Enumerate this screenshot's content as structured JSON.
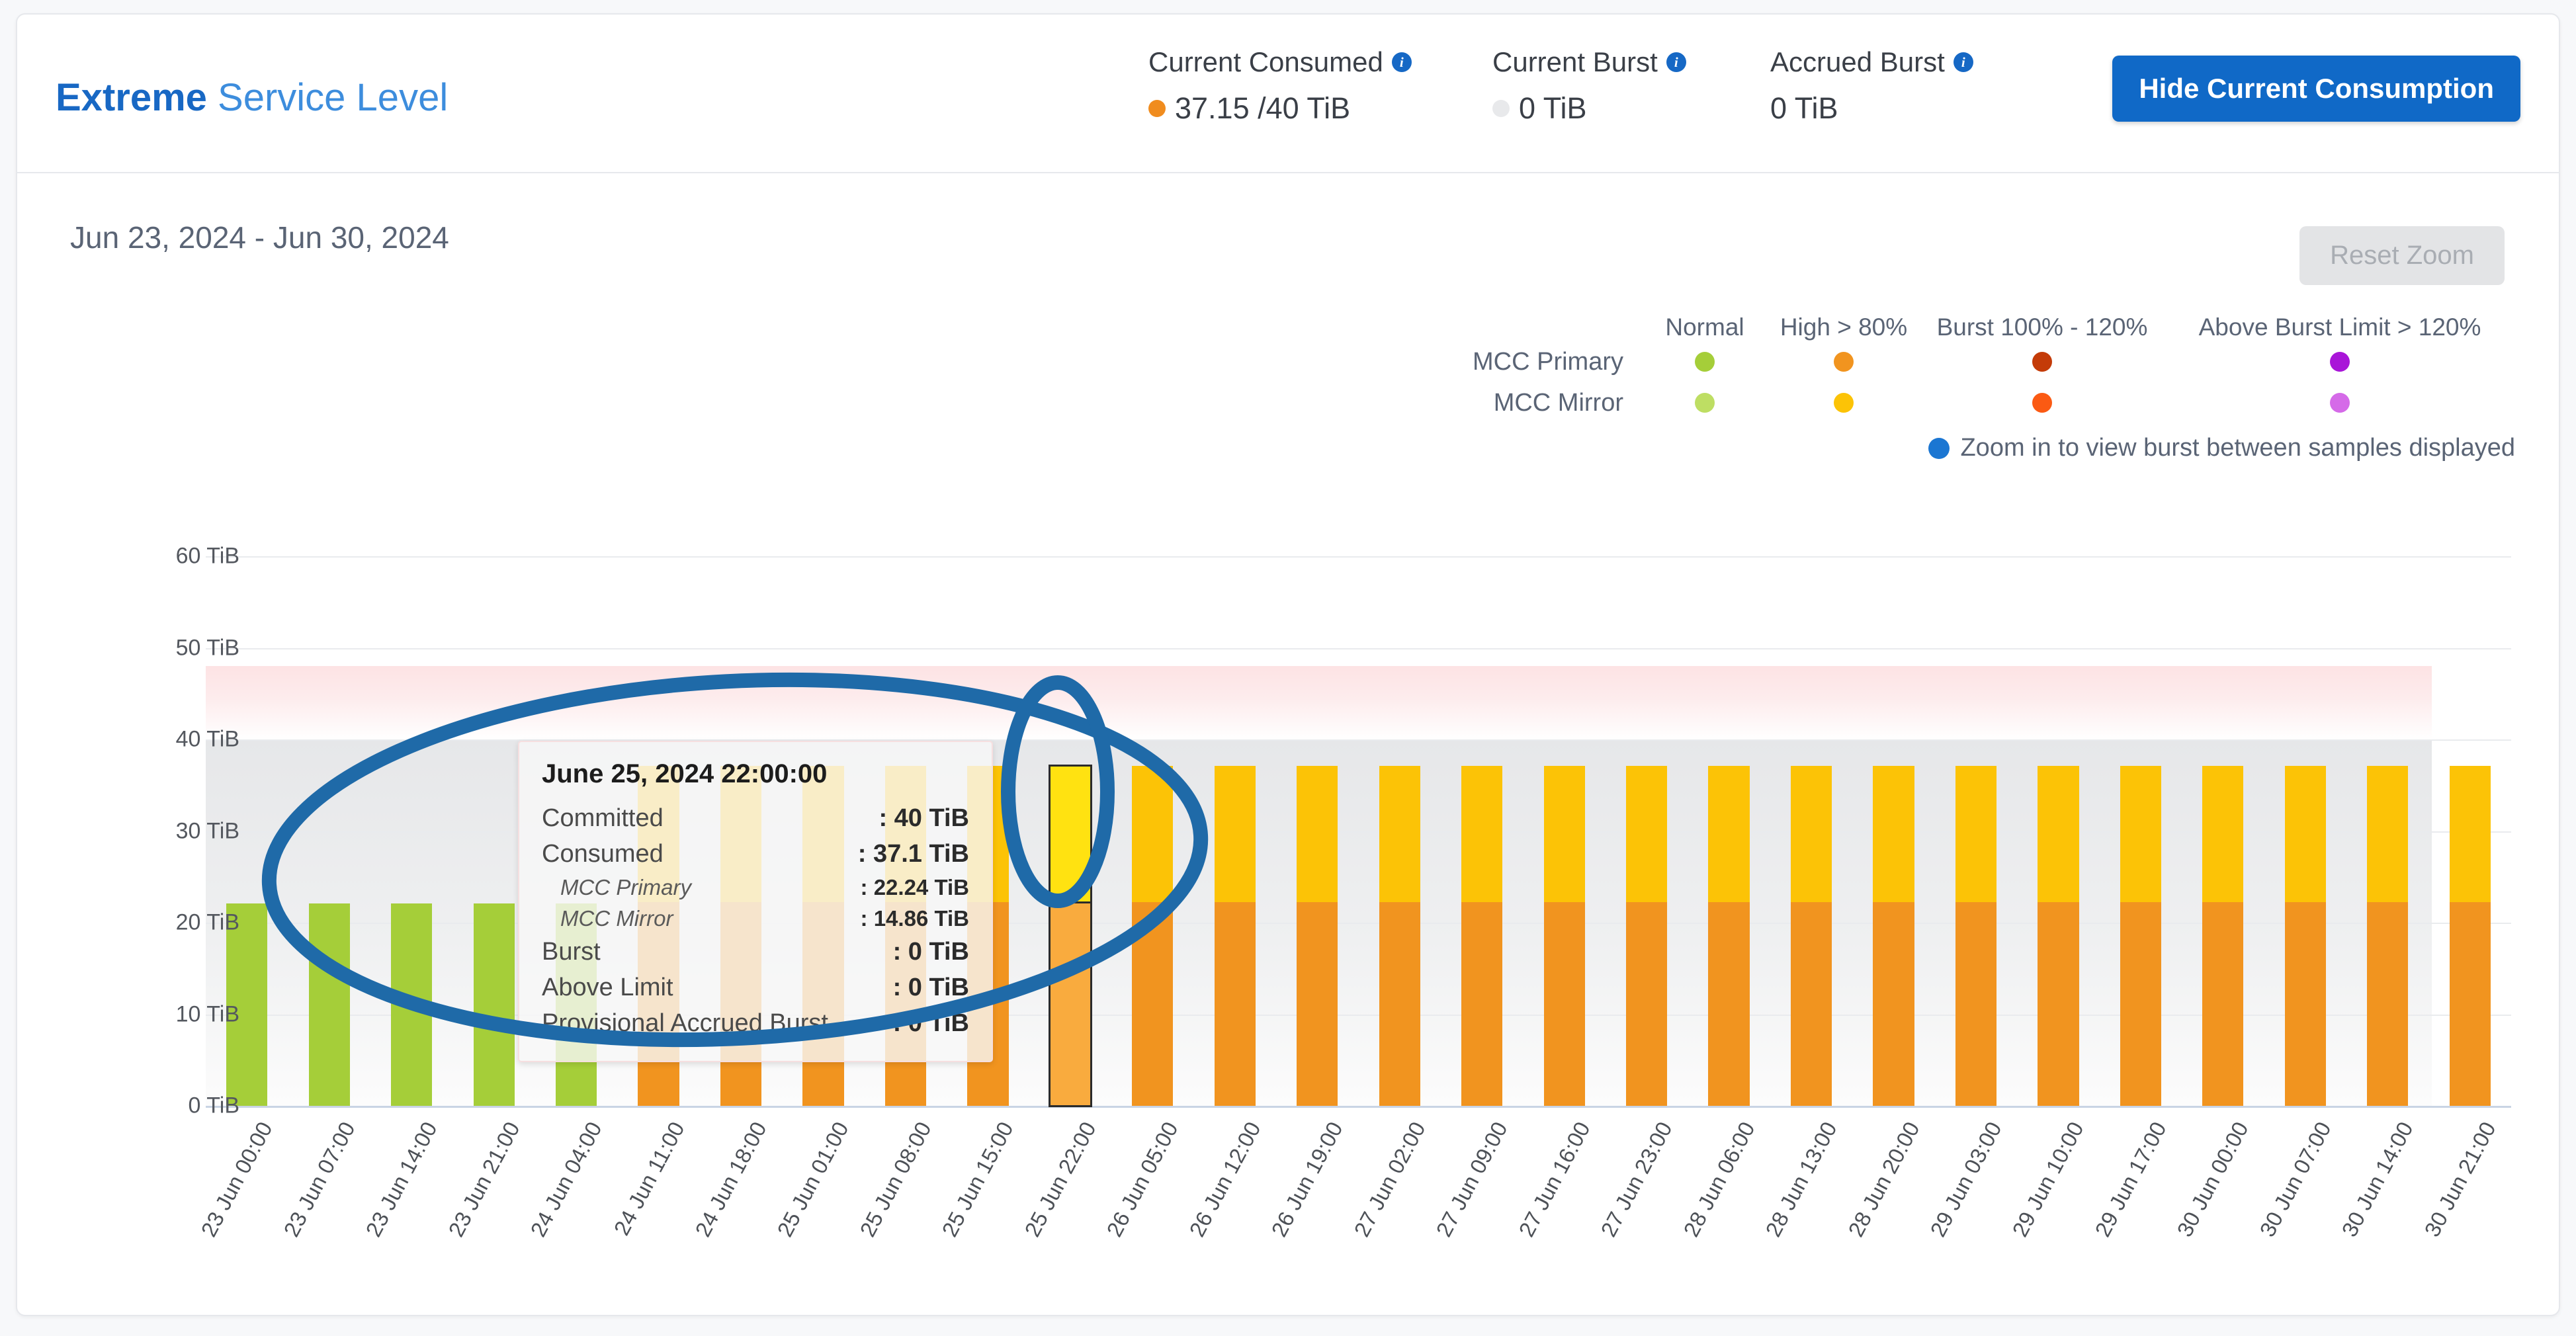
{
  "header": {
    "title_bold": "Extreme",
    "title_rest": " Service Level",
    "stats": [
      {
        "label": "Current Consumed",
        "info_icon": "info-icon",
        "value": "37.15 /40 TiB",
        "dot_color": "#f08c1e",
        "has_dot": true
      },
      {
        "label": "Current Burst",
        "info_icon": "info-icon",
        "value": "0 TiB",
        "dot_color": "#e8e9eb",
        "has_dot": true
      },
      {
        "label": "Accrued Burst",
        "info_icon": "info-icon",
        "value": "0 TiB",
        "dot_color": "",
        "has_dot": false
      }
    ],
    "hide_button": "Hide Current Consumption"
  },
  "toolbar": {
    "date_range": "Jun 23, 2024 - Jun 30, 2024",
    "reset_zoom": "Reset Zoom"
  },
  "legend": {
    "columns": [
      "Normal",
      "High > 80%",
      "Burst 100% - 120%",
      "Above Burst Limit > 120%"
    ],
    "rows": [
      {
        "name": "MCC Primary",
        "colors": [
          "#a5ce39",
          "#f1941f",
          "#c43b08",
          "#a915d8"
        ]
      },
      {
        "name": "MCC Mirror",
        "colors": [
          "#bede63",
          "#fcc306",
          "#fb5a13",
          "#d56ae8"
        ]
      }
    ],
    "note": "Zoom in to view burst between samples displayed",
    "note_dot_color": "#1b76d2"
  },
  "tooltip": {
    "title": "June 25, 2024 22:00:00",
    "rows": [
      {
        "key": "Committed",
        "value": ": 40 TiB",
        "sub": false
      },
      {
        "key": "Consumed",
        "value": ": 37.1 TiB",
        "sub": false
      },
      {
        "key": "MCC Primary",
        "value": ": 22.24 TiB",
        "sub": true
      },
      {
        "key": "MCC Mirror",
        "value": ": 14.86 TiB",
        "sub": true
      },
      {
        "key": "Burst",
        "value": ": 0 TiB",
        "sub": false
      },
      {
        "key": "Above Limit",
        "value": ": 0 TiB",
        "sub": false
      },
      {
        "key": "Provisional Accrued Burst",
        "value": ": 0 TiB",
        "sub": false
      }
    ]
  },
  "chart_data": {
    "type": "bar",
    "title": "",
    "xlabel": "",
    "ylabel": "",
    "ylim": [
      0,
      65
    ],
    "yticks": [
      0,
      10,
      20,
      30,
      40,
      50,
      60
    ],
    "ytick_labels": [
      "0 TiB",
      "10 TiB",
      "20 TiB",
      "30 TiB",
      "40 TiB",
      "50 TiB",
      "60 TiB"
    ],
    "grid": true,
    "stacked": true,
    "legend_position": "top-right",
    "committed_limit": 40,
    "plot_bands": [
      {
        "from": 40,
        "to": 48,
        "label": "above-committed",
        "color": "#fde3e4"
      },
      {
        "from": 0,
        "to": 40,
        "label": "committed",
        "color": "#e6e7e9"
      }
    ],
    "hovered_index": 10,
    "categories": [
      "23 Jun 00:00",
      "23 Jun 07:00",
      "23 Jun 14:00",
      "23 Jun 21:00",
      "24 Jun 04:00",
      "24 Jun 11:00",
      "24 Jun 18:00",
      "25 Jun 01:00",
      "25 Jun 08:00",
      "25 Jun 15:00",
      "25 Jun 22:00",
      "26 Jun 05:00",
      "26 Jun 12:00",
      "26 Jun 19:00",
      "27 Jun 02:00",
      "27 Jun 09:00",
      "27 Jun 16:00",
      "27 Jun 23:00",
      "28 Jun 06:00",
      "28 Jun 13:00",
      "28 Jun 20:00",
      "29 Jun 03:00",
      "29 Jun 10:00",
      "29 Jun 17:00",
      "30 Jun 00:00",
      "30 Jun 07:00",
      "30 Jun 14:00",
      "30 Jun 21:00"
    ],
    "series": [
      {
        "name": "MCC Primary",
        "colors": [
          "#a5ce39",
          "#f1941f"
        ],
        "values": [
          22.1,
          22.1,
          22.1,
          22.1,
          22.1,
          22.24,
          22.24,
          22.24,
          22.24,
          22.24,
          22.24,
          22.24,
          22.24,
          22.24,
          22.24,
          22.24,
          22.24,
          22.24,
          22.24,
          22.24,
          22.24,
          22.24,
          22.24,
          22.24,
          22.24,
          22.24,
          22.24,
          22.24
        ],
        "states": [
          "normal",
          "normal",
          "normal",
          "normal",
          "normal",
          "high",
          "high",
          "high",
          "high",
          "high",
          "high",
          "high",
          "high",
          "high",
          "high",
          "high",
          "high",
          "high",
          "high",
          "high",
          "high",
          "high",
          "high",
          "high",
          "high",
          "high",
          "high",
          "high"
        ]
      },
      {
        "name": "MCC Mirror",
        "colors": [
          "#bede63",
          "#fcc306"
        ],
        "values": [
          0,
          0,
          0,
          0,
          0,
          14.86,
          14.86,
          14.86,
          14.86,
          14.86,
          14.86,
          14.86,
          14.86,
          14.86,
          14.86,
          14.86,
          14.86,
          14.86,
          14.86,
          14.86,
          14.86,
          14.86,
          14.86,
          14.86,
          14.86,
          14.86,
          14.86,
          14.86
        ],
        "states": [
          "normal",
          "normal",
          "normal",
          "normal",
          "normal",
          "high",
          "high",
          "high",
          "high",
          "high",
          "high",
          "high",
          "high",
          "high",
          "high",
          "high",
          "high",
          "high",
          "high",
          "high",
          "high",
          "high",
          "high",
          "high",
          "high",
          "high",
          "high",
          "high"
        ]
      }
    ]
  },
  "annotations": {
    "color": "#1f6aa8",
    "shapes": [
      "ellipse-over-tooltip",
      "ellipse-over-hovered-bar"
    ]
  }
}
